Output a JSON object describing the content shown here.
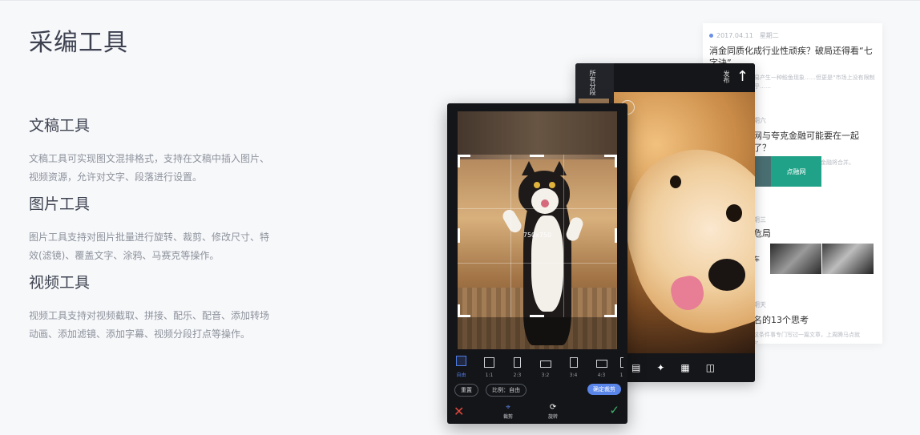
{
  "page": {
    "title": "采编工具"
  },
  "features": [
    {
      "title": "文稿工具",
      "desc": "文稿工具可实现图文混排格式，支持在文稿中插入图片、视频资源，允许对文字、段落进行设置。"
    },
    {
      "title": "图片工具",
      "desc": "图片工具支持对图片批量进行旋转、裁剪、修改尺寸、特效(滤镜)、覆盖文字、涂鸦、马赛克等操作。"
    },
    {
      "title": "视频工具",
      "desc": "视频工具支持对视频截取、拼接、配乐、配音、添加转场动画、添加滤镜、添加字幕、视频分段打点等操作。"
    }
  ],
  "news": {
    "items": [
      {
        "date": "2017.04.11",
        "weekday": "星期二",
        "title": "消金同质化成行业性顽疾？破局还得看“七字诀”",
        "summary": "任何一个行业都容易产生一种鲶鱼现象……但更是“市场上没有限制的金融机构，他几乎……"
      },
      {
        "weekday": "期六",
        "title": "网与夸克金融可能要在一起了？",
        "summary": "近期有传言：点融网和夸克金融将合并。"
      },
      {
        "weekday": "期三",
        "title": "危局"
      },
      {
        "weekday": "期天",
        "title": "名的13个思考",
        "summary": "这条件事专门写过一篇文章，上周腾马点就名……"
      }
    ],
    "thumb_logo": "点融网",
    "thumb_text": "车"
  },
  "editor_back": {
    "side_label": "所有分段",
    "publish_label": "发布",
    "arrow_icon": "up-arrow-icon"
  },
  "editor_front": {
    "dimension_label": "750x750",
    "ratios": [
      {
        "label": "自由",
        "active": true
      },
      {
        "label": "1:1"
      },
      {
        "label": "2:3"
      },
      {
        "label": "3:2"
      },
      {
        "label": "3:4"
      },
      {
        "label": "4:3"
      },
      {
        "label": "1"
      }
    ],
    "reset_label": "重置",
    "ratio_label": "比例：自由",
    "confirm_label": "确定裁剪",
    "crop_label": "裁剪",
    "rotate_label": "旋转"
  },
  "colors": {
    "accent": "#5a86ea",
    "cancel": "#e0483d",
    "ok": "#3fb16e",
    "dot": "#6a8fe5"
  }
}
